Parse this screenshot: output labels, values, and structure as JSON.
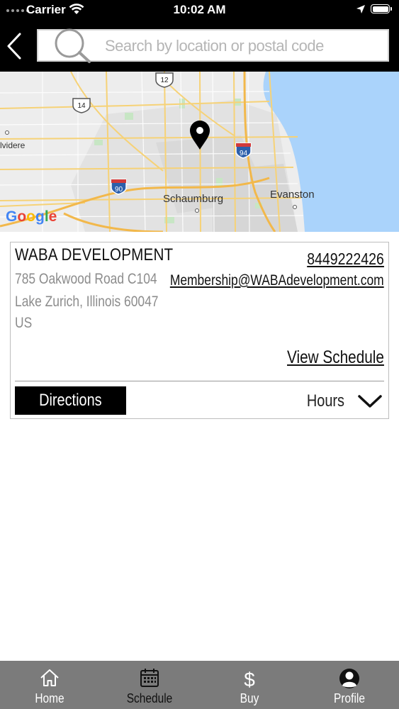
{
  "status_bar": {
    "carrier": "Carrier",
    "time": "10:02 AM"
  },
  "search": {
    "placeholder": "Search by location or postal code",
    "value": ""
  },
  "map": {
    "labels": {
      "city_1": "Schaumburg",
      "city_2": "Evanston",
      "city_3": "lvidere",
      "hwy_12": "12",
      "hwy_14": "14",
      "hwy_90": "90",
      "hwy_94": "94"
    },
    "attribution": "Google",
    "colors": {
      "water": "#aad3fb",
      "land": "#ededed",
      "roads": "#f6d277",
      "urban": "#dcdcdc",
      "parks": "#c5e8c5"
    }
  },
  "location": {
    "name": "WABA DEVELOPMENT",
    "address_line1": "785 Oakwood Road C104",
    "address_line2": "Lake Zurich, Illinois 60047",
    "country": "US",
    "phone": "8449222426",
    "email": "Membership@WABAdevelopment.com",
    "view_schedule_label": "View Schedule",
    "directions_label": "Directions",
    "hours_label": "Hours"
  },
  "tabs": [
    {
      "label": "Home",
      "icon": "home-icon"
    },
    {
      "label": "Schedule",
      "icon": "calendar-icon",
      "active": true
    },
    {
      "label": "Buy",
      "icon": "dollar-icon"
    },
    {
      "label": "Profile",
      "icon": "profile-icon"
    }
  ],
  "colors": {
    "header_bg": "#000000",
    "tab_bar_bg": "#7b7b7b",
    "active_tab_text": "#111111",
    "inactive_tab_text": "#ffffff"
  }
}
